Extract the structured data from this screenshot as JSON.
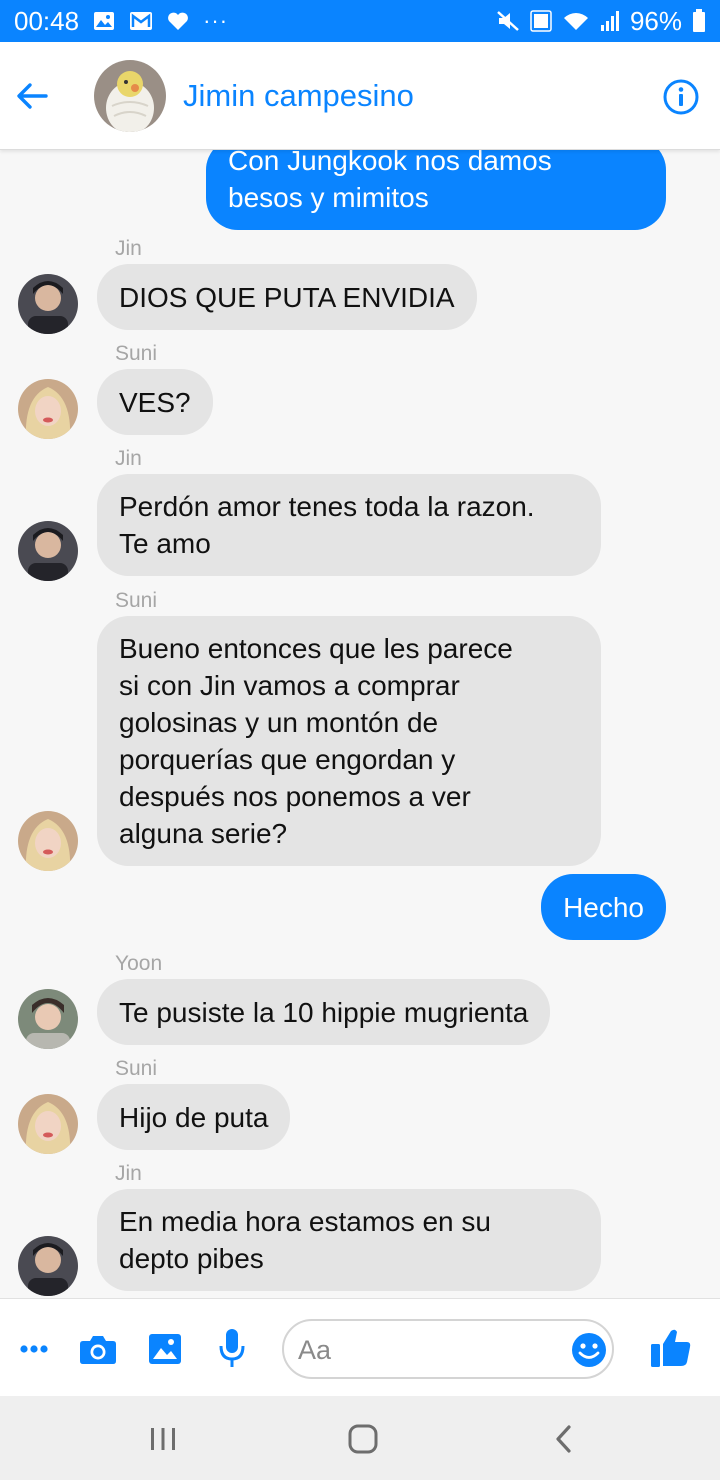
{
  "status_bar": {
    "time": "00:48",
    "overflow": "···",
    "battery": "96%",
    "icons": [
      "gallery-icon",
      "mail-icon",
      "heart-icon",
      "mute-icon",
      "volte-icon",
      "wifi-icon",
      "signal-icon",
      "battery-icon"
    ]
  },
  "header": {
    "title": "Jimin campesino",
    "icons": [
      "back-arrow-icon",
      "info-icon"
    ]
  },
  "colors": {
    "accent": "#0a84ff",
    "incoming_bubble": "#e4e4e4",
    "sender_label": "#a6a6a6"
  },
  "messages": [
    {
      "direction": "out",
      "text_lines": [
        "Con Jungkook nos damos",
        "besos y mimitos"
      ]
    },
    {
      "direction": "in",
      "sender": "Jin",
      "text_lines": [
        "DIOS QUE PUTA ENVIDIA"
      ]
    },
    {
      "direction": "in",
      "sender": "Suni",
      "text_lines": [
        "VES?"
      ]
    },
    {
      "direction": "in",
      "sender": "Jin",
      "text_lines": [
        "Perdón amor tenes toda la razon.",
        "Te amo"
      ]
    },
    {
      "direction": "in",
      "sender": "Suni",
      "text_lines": [
        "Bueno entonces que les parece",
        "si con Jin vamos a comprar",
        "golosinas y un montón de",
        "porquerías que engordan y",
        "después nos ponemos a ver",
        "alguna serie?"
      ]
    },
    {
      "direction": "out",
      "text_lines": [
        "Hecho"
      ]
    },
    {
      "direction": "in",
      "sender": "Yoon",
      "text_lines": [
        "Te pusiste la 10 hippie mugrienta"
      ]
    },
    {
      "direction": "in",
      "sender": "Suni",
      "text_lines": [
        "Hijo de puta"
      ]
    },
    {
      "direction": "in",
      "sender": "Jin",
      "text_lines": [
        "En media hora estamos en su",
        "depto pibes"
      ]
    }
  ],
  "composer": {
    "placeholder": "Aa",
    "icons": [
      "more-icon",
      "camera-icon",
      "image-icon",
      "microphone-icon",
      "emoji-icon",
      "thumbs-up-icon"
    ]
  },
  "nav_bar": {
    "icons": [
      "recent-apps-icon",
      "home-icon",
      "back-icon"
    ]
  }
}
